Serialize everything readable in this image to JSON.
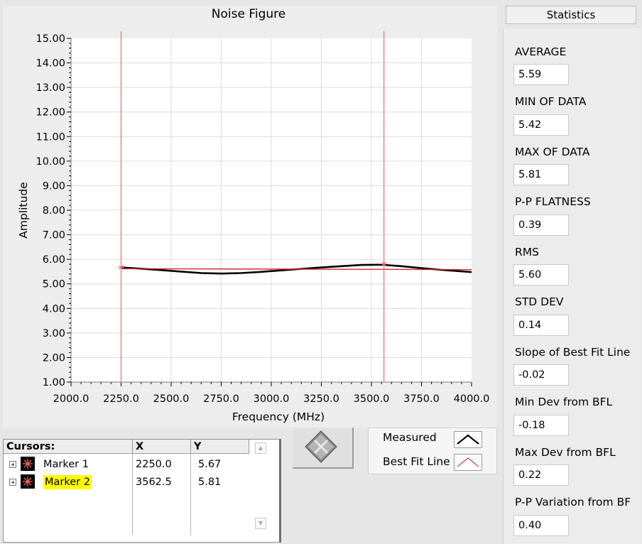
{
  "graph": {
    "title": "Noise Figure",
    "x_label": "Frequency (MHz)",
    "y_label": "Amplitude"
  },
  "chart_data": {
    "type": "line",
    "title": "Noise Figure",
    "xlabel": "Frequency (MHz)",
    "ylabel": "Amplitude",
    "xlim": [
      2000,
      4000
    ],
    "ylim": [
      1,
      15
    ],
    "x_ticks": [
      "2000.0",
      "2250.0",
      "2500.0",
      "2750.0",
      "3000.0",
      "3250.0",
      "3500.0",
      "3750.0",
      "4000.0"
    ],
    "y_ticks": [
      "1.00",
      "2.00",
      "3.00",
      "4.00",
      "5.00",
      "6.00",
      "7.00",
      "8.00",
      "9.00",
      "10.00",
      "11.00",
      "12.00",
      "13.00",
      "14.00",
      "15.00"
    ],
    "grid": true,
    "series": [
      {
        "name": "Measured",
        "color": "#000000",
        "x": [
          2250,
          2350,
          2450,
          2550,
          2650,
          2750,
          2850,
          2950,
          3050,
          3150,
          3250,
          3350,
          3450,
          3550,
          3650,
          3750,
          3850,
          3950,
          4000
        ],
        "y": [
          5.67,
          5.62,
          5.56,
          5.5,
          5.44,
          5.42,
          5.44,
          5.49,
          5.55,
          5.61,
          5.67,
          5.72,
          5.77,
          5.78,
          5.72,
          5.64,
          5.57,
          5.51,
          5.48
        ]
      },
      {
        "name": "Best Fit Line",
        "color": "#d62728",
        "x": [
          2250,
          4000
        ],
        "y": [
          5.62,
          5.58
        ]
      }
    ],
    "cursors": [
      {
        "name": "Marker 1",
        "x": 2250.0,
        "y": 5.67
      },
      {
        "name": "Marker 2",
        "x": 3562.5,
        "y": 5.81
      }
    ]
  },
  "cursors_table": {
    "headers": [
      "Cursors:",
      "X",
      "Y"
    ],
    "rows": [
      {
        "name": "Marker 1",
        "x": "2250.0",
        "y": "5.67",
        "highlight": false
      },
      {
        "name": "Marker 2",
        "x": "3562.5",
        "y": "5.81",
        "highlight": true
      }
    ]
  },
  "legend": {
    "measured_label": "Measured",
    "bestfit_label": "Best Fit Line"
  },
  "statistics": {
    "title": "Statistics",
    "items": [
      {
        "label": "AVERAGE",
        "value": "5.59"
      },
      {
        "label": "MIN OF DATA",
        "value": "5.42"
      },
      {
        "label": "MAX OF DATA",
        "value": "5.81"
      },
      {
        "label": "P-P FLATNESS",
        "value": "0.39"
      },
      {
        "label": "RMS",
        "value": "5.60"
      },
      {
        "label": "STD DEV",
        "value": "0.14"
      },
      {
        "label": "Slope of Best Fit Line",
        "value": "-0.02"
      },
      {
        "label": "Min Dev from BFL",
        "value": "-0.18"
      },
      {
        "label": "Max Dev from BFL",
        "value": "0.22"
      },
      {
        "label": "P-P Variation from BF",
        "value": "0.40"
      }
    ]
  },
  "colors": {
    "cursor_line": "#e0707a",
    "highlight": "#ffff00",
    "grid": "#dcdcdc"
  }
}
